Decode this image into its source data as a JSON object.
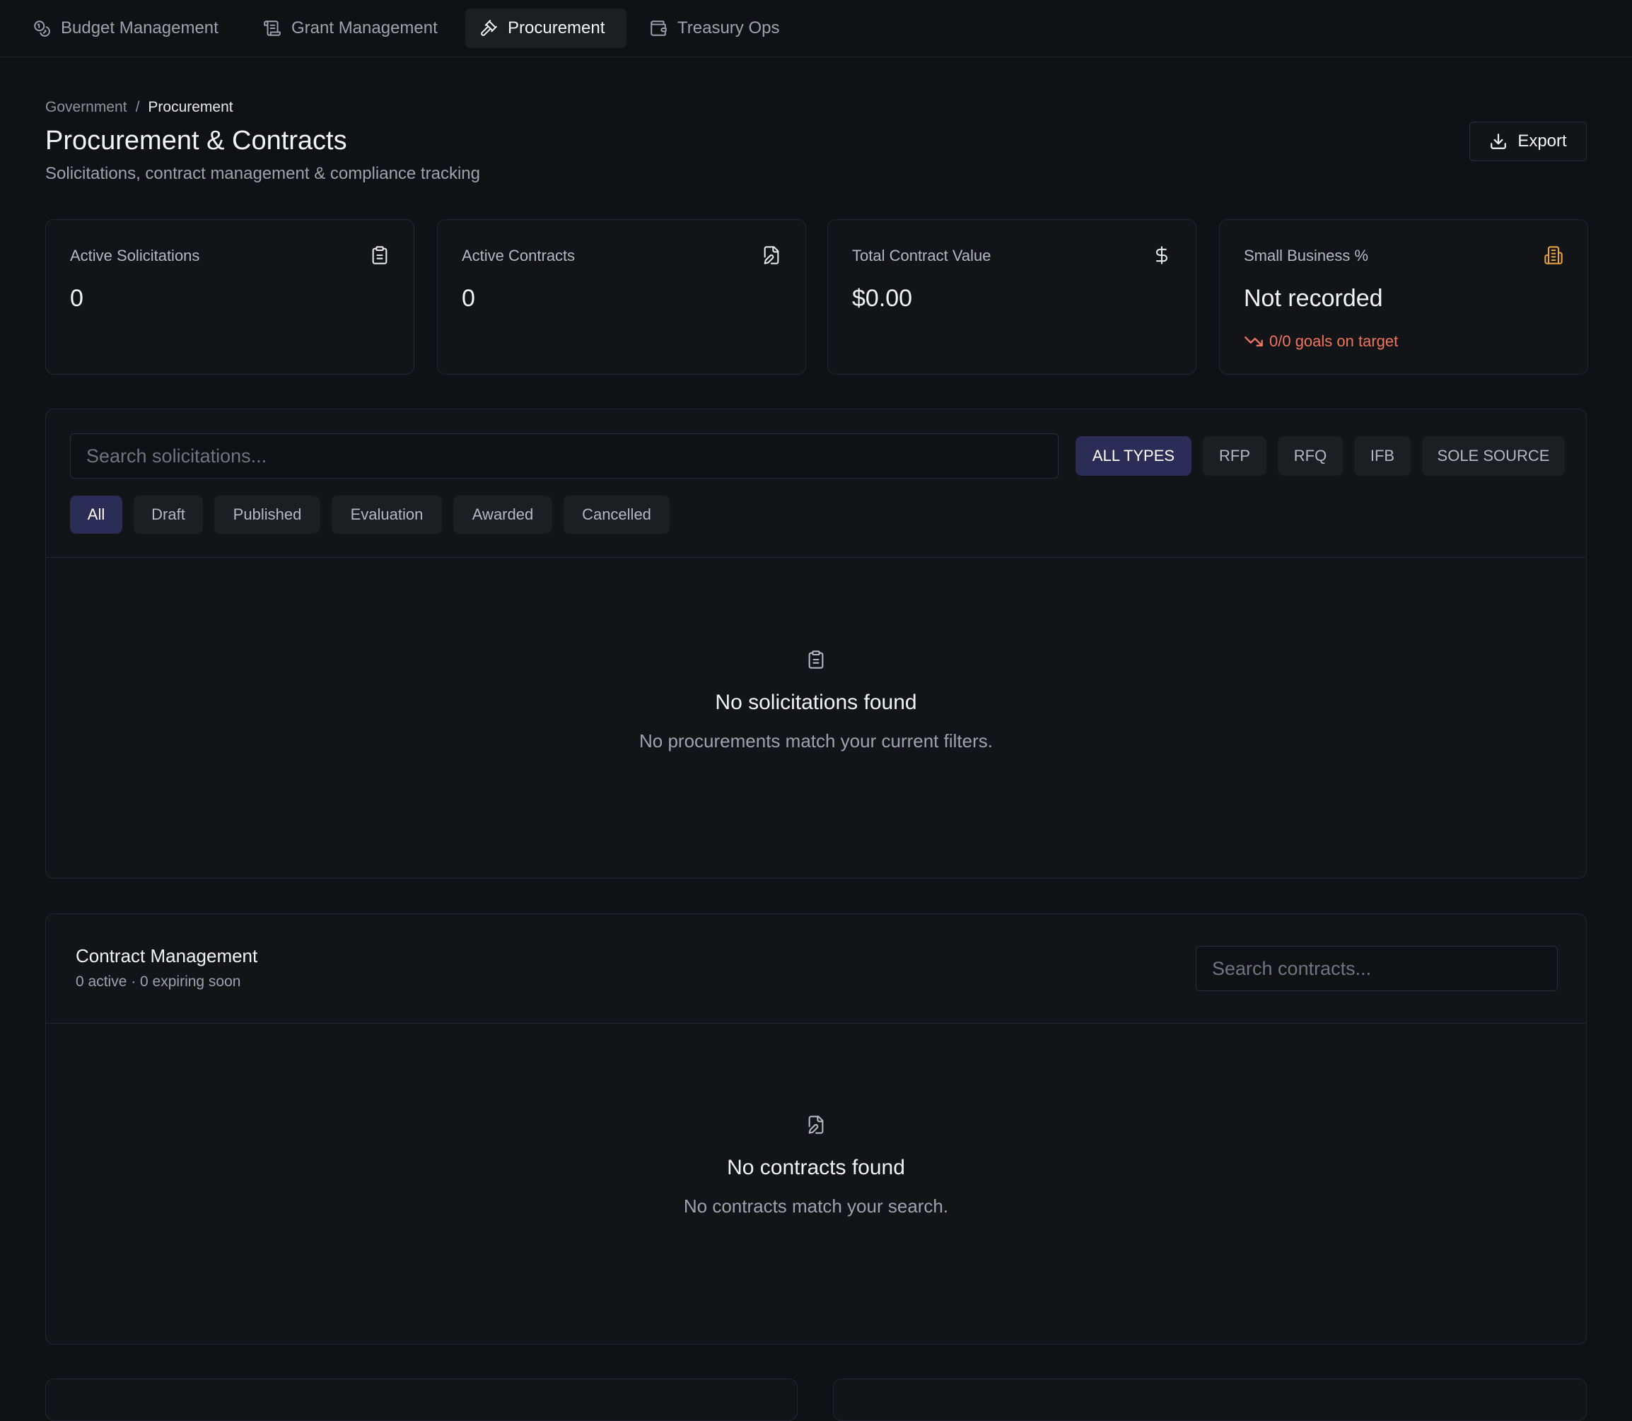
{
  "nav": {
    "tabs": [
      {
        "label": "Budget Management",
        "icon": "budget-coins-icon"
      },
      {
        "label": "Grant Management",
        "icon": "scroll-icon"
      },
      {
        "label": "Procurement",
        "icon": "gavel-icon",
        "active": true
      },
      {
        "label": "Treasury Ops",
        "icon": "wallet-icon"
      }
    ]
  },
  "breadcrumb": {
    "root": "Government",
    "separator": "/",
    "current": "Procurement"
  },
  "header": {
    "title": "Procurement & Contracts",
    "subtitle": "Solicitations, contract management & compliance tracking",
    "export_label": "Export"
  },
  "stats": [
    {
      "label": "Active Solicitations",
      "value": "0",
      "icon": "clipboard-icon"
    },
    {
      "label": "Active Contracts",
      "value": "0",
      "icon": "file-edit-icon"
    },
    {
      "label": "Total Contract Value",
      "value": "$0.00",
      "icon": "dollar-icon"
    },
    {
      "label": "Small Business %",
      "value": "Not recorded",
      "icon": "building-icon",
      "trend": "0/0 goals on target"
    }
  ],
  "solicitations": {
    "search_placeholder": "Search solicitations...",
    "type_filters": [
      "ALL TYPES",
      "RFP",
      "RFQ",
      "IFB",
      "SOLE SOURCE"
    ],
    "status_filters": [
      "All",
      "Draft",
      "Published",
      "Evaluation",
      "Awarded",
      "Cancelled"
    ],
    "empty_title": "No solicitations found",
    "empty_text": "No procurements match your current filters."
  },
  "contracts": {
    "title": "Contract Management",
    "summary": "0 active · 0 expiring soon",
    "search_placeholder": "Search contracts...",
    "empty_title": "No contracts found",
    "empty_text": "No contracts match your search."
  },
  "colors": {
    "background": "#0f1114",
    "card": "#121418",
    "accent_chip": "#2b2d57",
    "warning_gold": "#e6a23c",
    "trend_red": "#f0745e"
  }
}
